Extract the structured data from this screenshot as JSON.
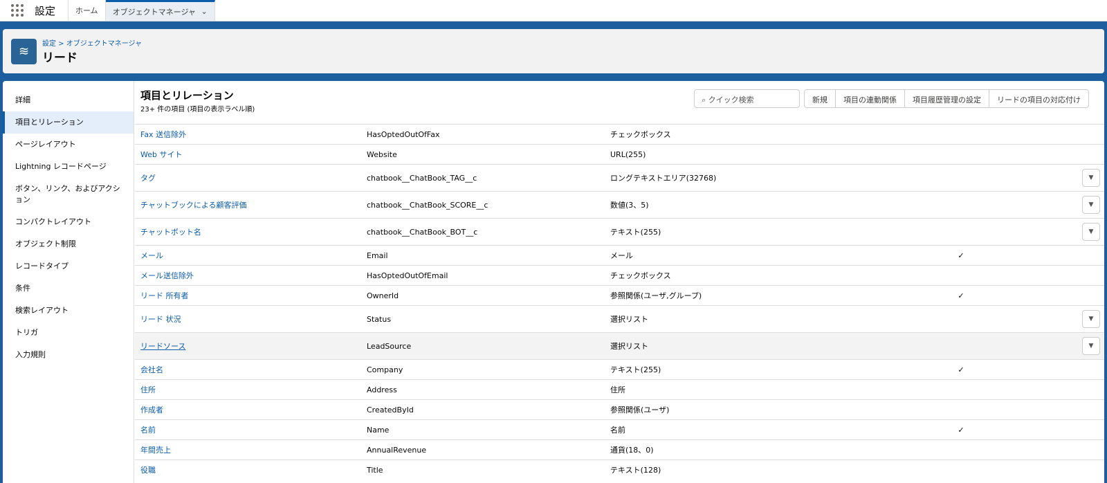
{
  "app": {
    "name": "設定",
    "tabs": [
      {
        "label": "ホーム"
      },
      {
        "label": "オブジェクトマネージャ"
      }
    ]
  },
  "header": {
    "breadcrumb": "設定 > オブジェクトマネージャ",
    "title": "リード"
  },
  "sidebar": {
    "items": [
      {
        "label": "詳細"
      },
      {
        "label": "項目とリレーション"
      },
      {
        "label": "ページレイアウト"
      },
      {
        "label": "Lightning レコードページ"
      },
      {
        "label": "ボタン、リンク、およびアクション"
      },
      {
        "label": "コンパクトレイアウト"
      },
      {
        "label": "オブジェクト制限"
      },
      {
        "label": "レコードタイプ"
      },
      {
        "label": "条件"
      },
      {
        "label": "検索レイアウト"
      },
      {
        "label": "トリガ"
      },
      {
        "label": "入力規則"
      }
    ]
  },
  "content": {
    "title": "項目とリレーション",
    "subtitle": "23+ 件の項目 (項目の表示ラベル順)",
    "search_placeholder": "クイック検索",
    "buttons": [
      {
        "label": "新規"
      },
      {
        "label": "項目の連動関係"
      },
      {
        "label": "項目履歴管理の設定"
      },
      {
        "label": "リードの項目の対応付け"
      }
    ]
  },
  "rows": [
    {
      "label": "Fax 送信除外",
      "api": "HasOptedOutOfFax",
      "type": "チェックボックス",
      "indexed": false,
      "menu": false
    },
    {
      "label": "Web サイト",
      "api": "Website",
      "type": "URL(255)",
      "indexed": false,
      "menu": false
    },
    {
      "label": "タグ",
      "api": "chatbook__ChatBook_TAG__c",
      "type": "ロングテキストエリア(32768)",
      "indexed": false,
      "menu": true
    },
    {
      "label": "チャットブックによる顧客評価",
      "api": "chatbook__ChatBook_SCORE__c",
      "type": "数値(3、5)",
      "indexed": false,
      "menu": true
    },
    {
      "label": "チャットボット名",
      "api": "chatbook__ChatBook_BOT__c",
      "type": "テキスト(255)",
      "indexed": false,
      "menu": true
    },
    {
      "label": "メール",
      "api": "Email",
      "type": "メール",
      "indexed": true,
      "menu": false
    },
    {
      "label": "メール送信除外",
      "api": "HasOptedOutOfEmail",
      "type": "チェックボックス",
      "indexed": false,
      "menu": false
    },
    {
      "label": "リード 所有者",
      "api": "OwnerId",
      "type": "参照関係(ユーザ,グループ)",
      "indexed": true,
      "menu": false
    },
    {
      "label": "リード 状況",
      "api": "Status",
      "type": "選択リスト",
      "indexed": false,
      "menu": true
    },
    {
      "label": "リードソース",
      "api": "LeadSource",
      "type": "選択リスト",
      "indexed": false,
      "menu": true,
      "highlight": true
    },
    {
      "label": "会社名",
      "api": "Company",
      "type": "テキスト(255)",
      "indexed": true,
      "menu": false
    },
    {
      "label": "住所",
      "api": "Address",
      "type": "住所",
      "indexed": false,
      "menu": false
    },
    {
      "label": "作成者",
      "api": "CreatedById",
      "type": "参照関係(ユーザ)",
      "indexed": false,
      "menu": false
    },
    {
      "label": "名前",
      "api": "Name",
      "type": "名前",
      "indexed": true,
      "menu": false
    },
    {
      "label": "年間売上",
      "api": "AnnualRevenue",
      "type": "通貨(18、0)",
      "indexed": false,
      "menu": false
    },
    {
      "label": "役職",
      "api": "Title",
      "type": "テキスト(128)",
      "indexed": false,
      "menu": false
    }
  ]
}
